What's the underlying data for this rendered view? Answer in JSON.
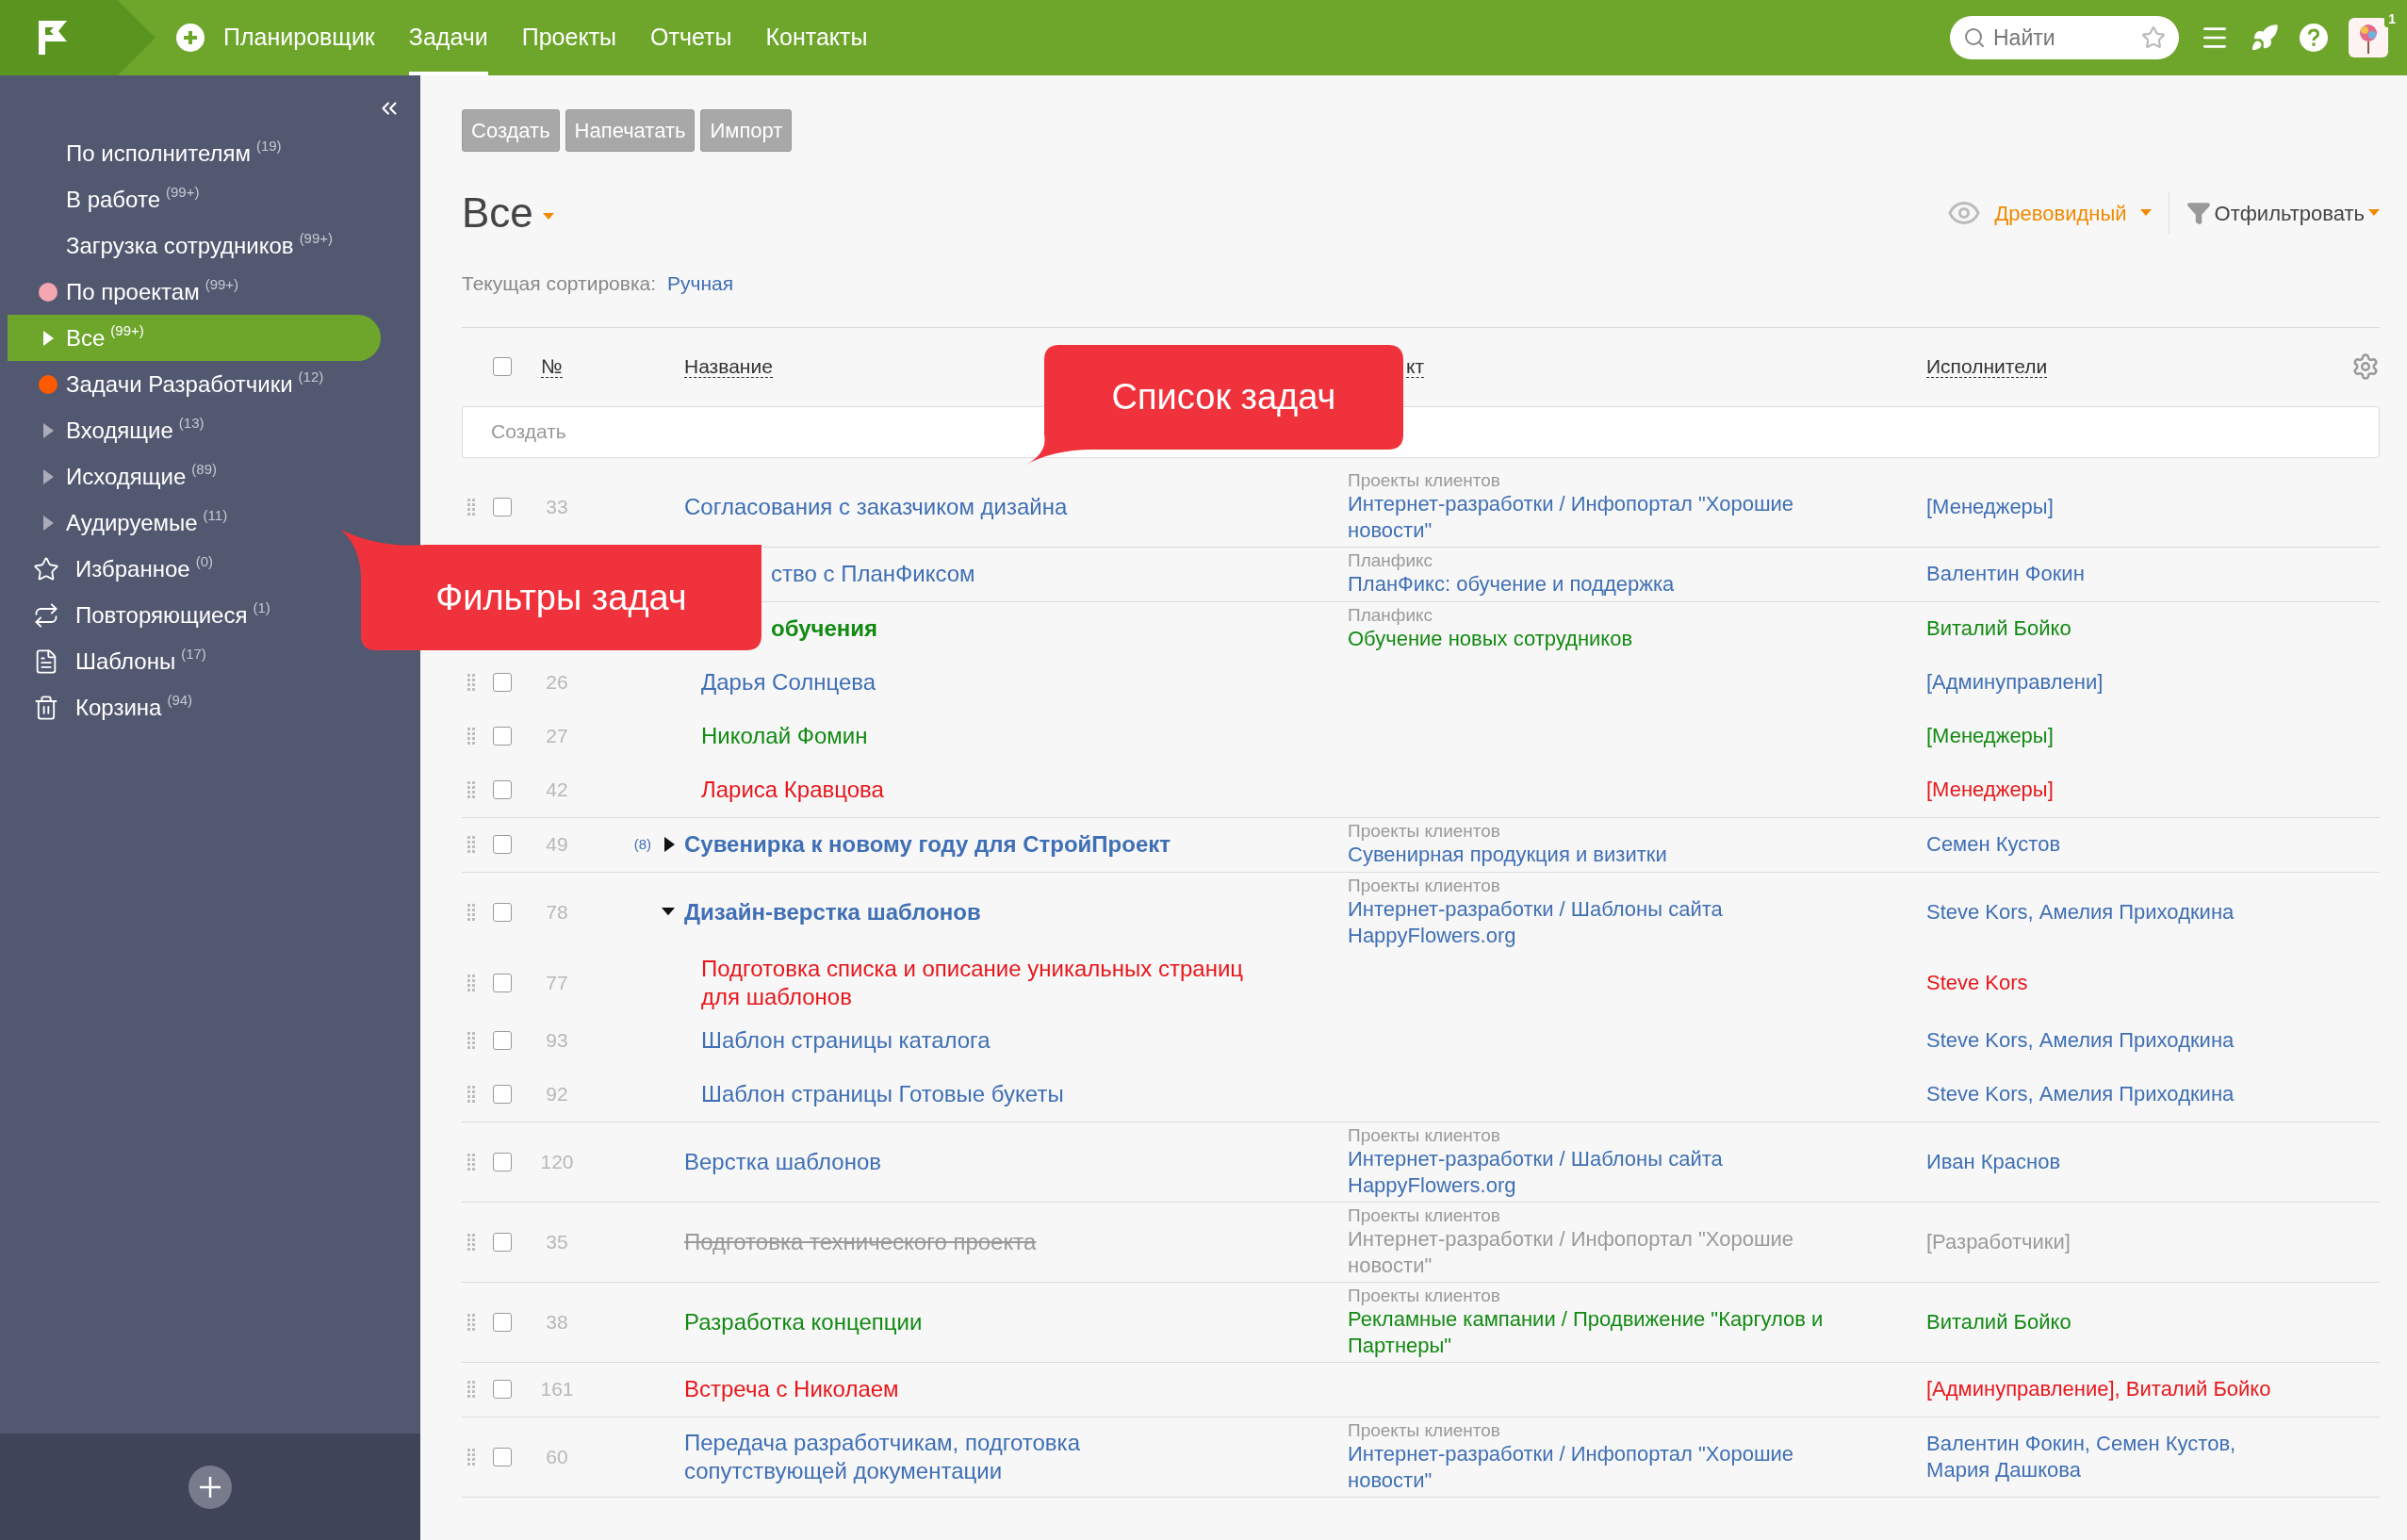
{
  "nav": {
    "tabs": [
      {
        "label": "Планировщик",
        "selected": false
      },
      {
        "label": "Задачи",
        "selected": true
      },
      {
        "label": "Проекты",
        "selected": false
      },
      {
        "label": "Отчеты",
        "selected": false
      },
      {
        "label": "Контакты",
        "selected": false
      }
    ],
    "search": {
      "placeholder": "Найти"
    },
    "notifications": "1"
  },
  "sidebar": {
    "items": [
      {
        "kind": "plain",
        "label": "По исполнителям",
        "count": "(19)",
        "selected": false
      },
      {
        "kind": "plain",
        "label": "В работе",
        "count": "(99+)",
        "selected": false
      },
      {
        "kind": "plain",
        "label": "Загрузка сотрудников",
        "count": "(99+)",
        "selected": false
      },
      {
        "kind": "dot",
        "label": "По проектам",
        "count": "(99+)",
        "color": "#f4a7b3",
        "selected": false
      },
      {
        "kind": "arrow",
        "label": "Все",
        "count": "(99+)",
        "selected": true
      },
      {
        "kind": "dot",
        "label": "Задачи Разработчики",
        "count": "(12)",
        "color": "#ff5a00",
        "selected": false
      },
      {
        "kind": "arrow",
        "label": "Входящие",
        "count": "(13)",
        "selected": false
      },
      {
        "kind": "arrow",
        "label": "Исходящие",
        "count": "(89)",
        "selected": false
      },
      {
        "kind": "arrow",
        "label": "Аудируемые",
        "count": "(11)",
        "selected": false
      },
      {
        "kind": "star",
        "label": "Избранное",
        "count": "(0)",
        "selected": false
      },
      {
        "kind": "repeat",
        "label": "Повторяющиеся",
        "count": "(1)",
        "selected": false
      },
      {
        "kind": "template",
        "label": "Шаблоны",
        "count": "(17)",
        "selected": false
      },
      {
        "kind": "trash",
        "label": "Корзина",
        "count": "(94)",
        "selected": false
      }
    ]
  },
  "toolbar": {
    "buttons": [
      "Создать",
      "Напечатать",
      "Импорт"
    ]
  },
  "heading": "Все",
  "view": "Древовидный",
  "filter": "Отфильтровать",
  "sort": {
    "label": "Текущая сортировка:",
    "value": "Ручная"
  },
  "table": {
    "select_all_checked": false,
    "columns": [
      "№",
      "Название",
      "кт",
      "Исполнители"
    ],
    "quick_create": {
      "placeholder": "Создать"
    }
  },
  "tasks": [
    {
      "kind": "task",
      "number": "33",
      "checked": false,
      "title": "Согласования с заказчиком дизайна",
      "completed": false,
      "color": "#3f6fb5",
      "project_group": "Проекты клиентов",
      "project": "Интернет-разработки / Инфопортал \"Хорошие новости\"",
      "assignees": "[Менеджеры]"
    },
    {
      "kind": "task",
      "title": "ство с ПланФиксом",
      "completed": false,
      "color": "#3f6fb5",
      "project_group": "Планфикс",
      "project": "ПланФикс: обучение и поддержка",
      "assignees": "Валентин Фокин"
    },
    {
      "kind": "group",
      "title": "обучения",
      "completed": false,
      "color": "#128a12",
      "project_group": "Планфикс",
      "project": "Обучение новых сотрудников",
      "assignees": "Виталий Бойко",
      "children": [
        {
          "kind": "task",
          "number": "26",
          "checked": false,
          "title": "Дарья Солнцева",
          "completed": false,
          "color": "#3f6fb5",
          "assignees": "[Админуправлени]"
        },
        {
          "kind": "task",
          "number": "27",
          "checked": false,
          "title": "Николай Фомин",
          "completed": false,
          "color": "#128a12",
          "assignees": "[Менеджеры]"
        },
        {
          "kind": "task",
          "number": "42",
          "checked": false,
          "title": "Лариса Кравцова",
          "completed": false,
          "color": "#e8171b",
          "assignees": "[Менеджеры]"
        }
      ]
    },
    {
      "kind": "group",
      "number": "49",
      "checked": false,
      "subtask_count": "(8)",
      "expanded": false,
      "title": "Сувенирка к новому году для СтройПроект",
      "completed": false,
      "color": "#3f6fb5",
      "project_group": "Проекты клиентов",
      "project": "Сувенирная продукция и визитки",
      "assignees": "Семен Кустов"
    },
    {
      "kind": "group",
      "number": "78",
      "checked": false,
      "expanded": true,
      "title": "Дизайн-верстка шаблонов",
      "completed": false,
      "color": "#3f6fb5",
      "project_group": "Проекты клиентов",
      "project": "Интернет-разработки / Шаблоны сайта HappyFlowers.org",
      "assignees": "Steve Kors, Амелия Приходкина",
      "children": [
        {
          "kind": "task",
          "number": "77",
          "checked": false,
          "title": "Подготовка списка и описание уникальных страниц для шаблонов",
          "completed": false,
          "color": "#e8171b",
          "assignees": "Steve Kors"
        },
        {
          "kind": "task",
          "number": "93",
          "checked": false,
          "title": "Шаблон страницы каталога",
          "completed": false,
          "color": "#3f6fb5",
          "assignees": "Steve Kors, Амелия Приходкина"
        },
        {
          "kind": "task",
          "number": "92",
          "checked": false,
          "title": "Шаблон страницы Готовые букеты",
          "completed": false,
          "color": "#3f6fb5",
          "assignees": "Steve Kors, Амелия Приходкина"
        }
      ]
    },
    {
      "kind": "task",
      "number": "120",
      "checked": false,
      "title": "Верстка шаблонов",
      "completed": false,
      "color": "#3f6fb5",
      "project_group": "Проекты клиентов",
      "project": "Интернет-разработки / Шаблоны сайта HappyFlowers.org",
      "assignees": "Иван Краснов"
    },
    {
      "kind": "task",
      "number": "35",
      "checked": false,
      "title": "Подготовка технического проекта",
      "completed": true,
      "color": "#9a9a9a",
      "project_group": "Проекты клиентов",
      "project": "Интернет-разработки / Инфопортал \"Хорошие новости\"",
      "assignees": "[Разработчики]"
    },
    {
      "kind": "task",
      "number": "38",
      "checked": false,
      "title": "Разработка концепции",
      "completed": false,
      "color": "#128a12",
      "project_group": "Проекты клиентов",
      "project": "Рекламные кампании / Продвижение \"Каргулов и Партнеры\"",
      "assignees": "Виталий Бойко"
    },
    {
      "kind": "task",
      "number": "161",
      "checked": false,
      "title": "Встреча с Николаем",
      "completed": false,
      "color": "#e8171b",
      "assignees": "[Админуправление], Виталий Бойко"
    },
    {
      "kind": "task",
      "number": "60",
      "checked": false,
      "title": "Передача разработчикам, подготовка сопутствующей документации",
      "completed": false,
      "color": "#3f6fb5",
      "project_group": "Проекты клиентов",
      "project": "Интернет-разработки / Инфопортал \"Хорошие новости\"",
      "assignees": "Валентин Фокин, Семен Кустов, Мария Дашкова"
    }
  ],
  "callouts": [
    {
      "text": "Список задач"
    },
    {
      "text": "Фильтры задач"
    }
  ]
}
